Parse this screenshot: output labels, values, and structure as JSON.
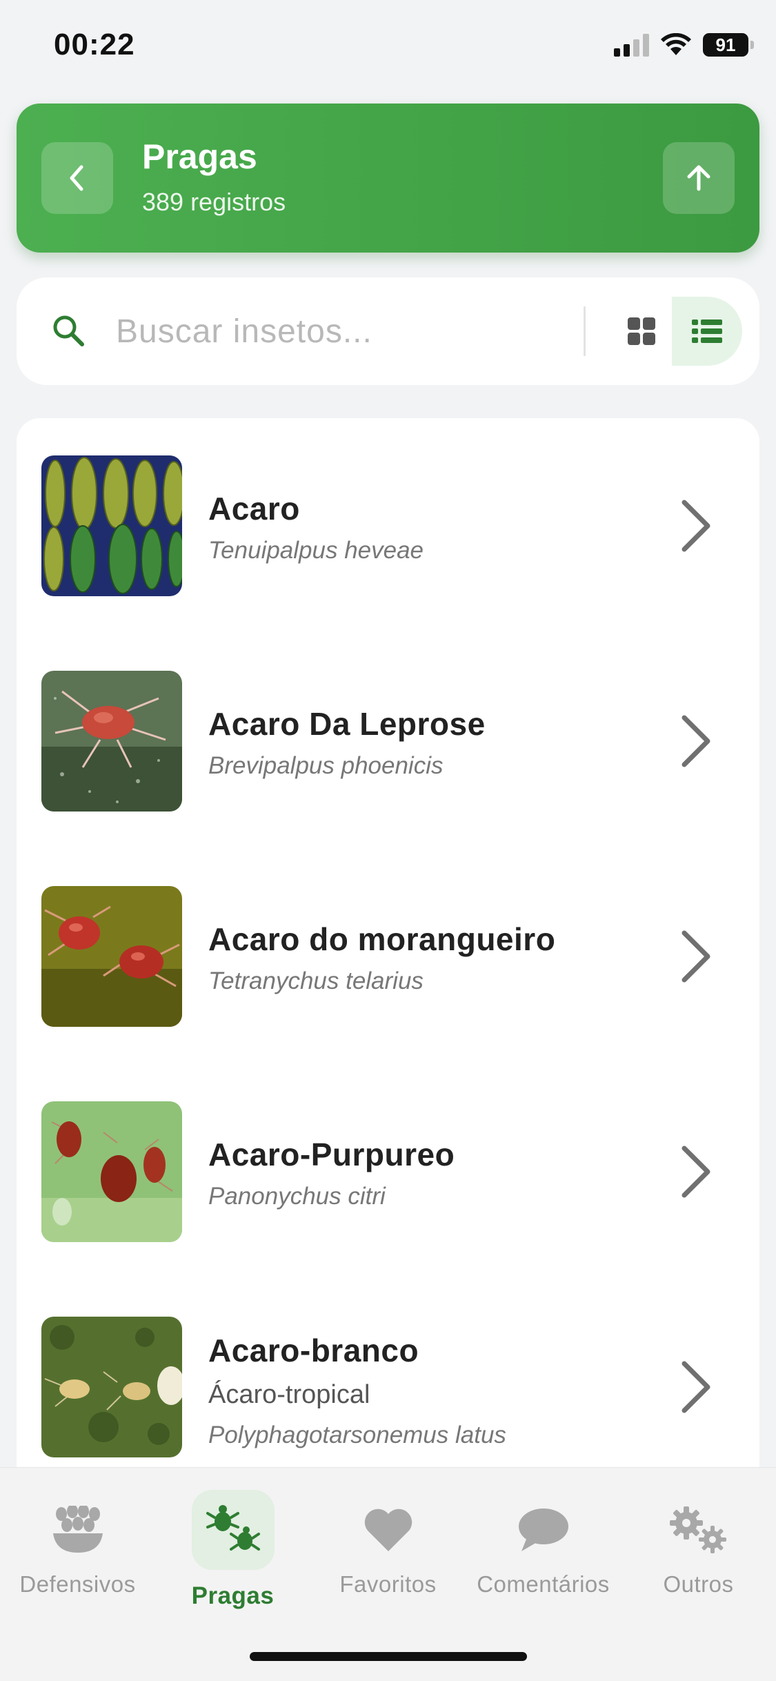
{
  "status_bar": {
    "time": "00:22",
    "battery": "91"
  },
  "header": {
    "title": "Pragas",
    "subtitle": "389 registros"
  },
  "search": {
    "placeholder": "Buscar insetos...",
    "value": ""
  },
  "view_mode": {
    "selected": "list",
    "options": [
      "grid-icon",
      "list-icon"
    ]
  },
  "items": [
    {
      "name": "Acaro",
      "common_name": "",
      "scientific_name": "Tenuipalpus heveae",
      "thumb": "leaves-photo"
    },
    {
      "name": "Acaro Da Leprose",
      "common_name": "",
      "scientific_name": "Brevipalpus phoenicis",
      "thumb": "mite-photo"
    },
    {
      "name": "Acaro do morangueiro",
      "common_name": "",
      "scientific_name": "Tetranychus telarius",
      "thumb": "red-mites-photo"
    },
    {
      "name": "Acaro-Purpureo",
      "common_name": "",
      "scientific_name": "Panonychus citri",
      "thumb": "purple-mites-photo"
    },
    {
      "name": "Acaro-branco",
      "common_name": "Ácaro-tropical",
      "scientific_name": "Polyphagotarsonemus latus",
      "thumb": "white-mites-photo"
    }
  ],
  "nav": [
    {
      "label": "Defensivos",
      "icon": "seeds-icon",
      "active": false
    },
    {
      "label": "Pragas",
      "icon": "bugs-icon",
      "active": true
    },
    {
      "label": "Favoritos",
      "icon": "heart-icon",
      "active": false
    },
    {
      "label": "Comentários",
      "icon": "chat-bubble-icon",
      "active": false
    },
    {
      "label": "Outros",
      "icon": "gears-icon",
      "active": false
    }
  ],
  "colors": {
    "primary": "#4caf50",
    "primary_dark": "#2e7d32",
    "active_bg": "#e6f4e7"
  }
}
